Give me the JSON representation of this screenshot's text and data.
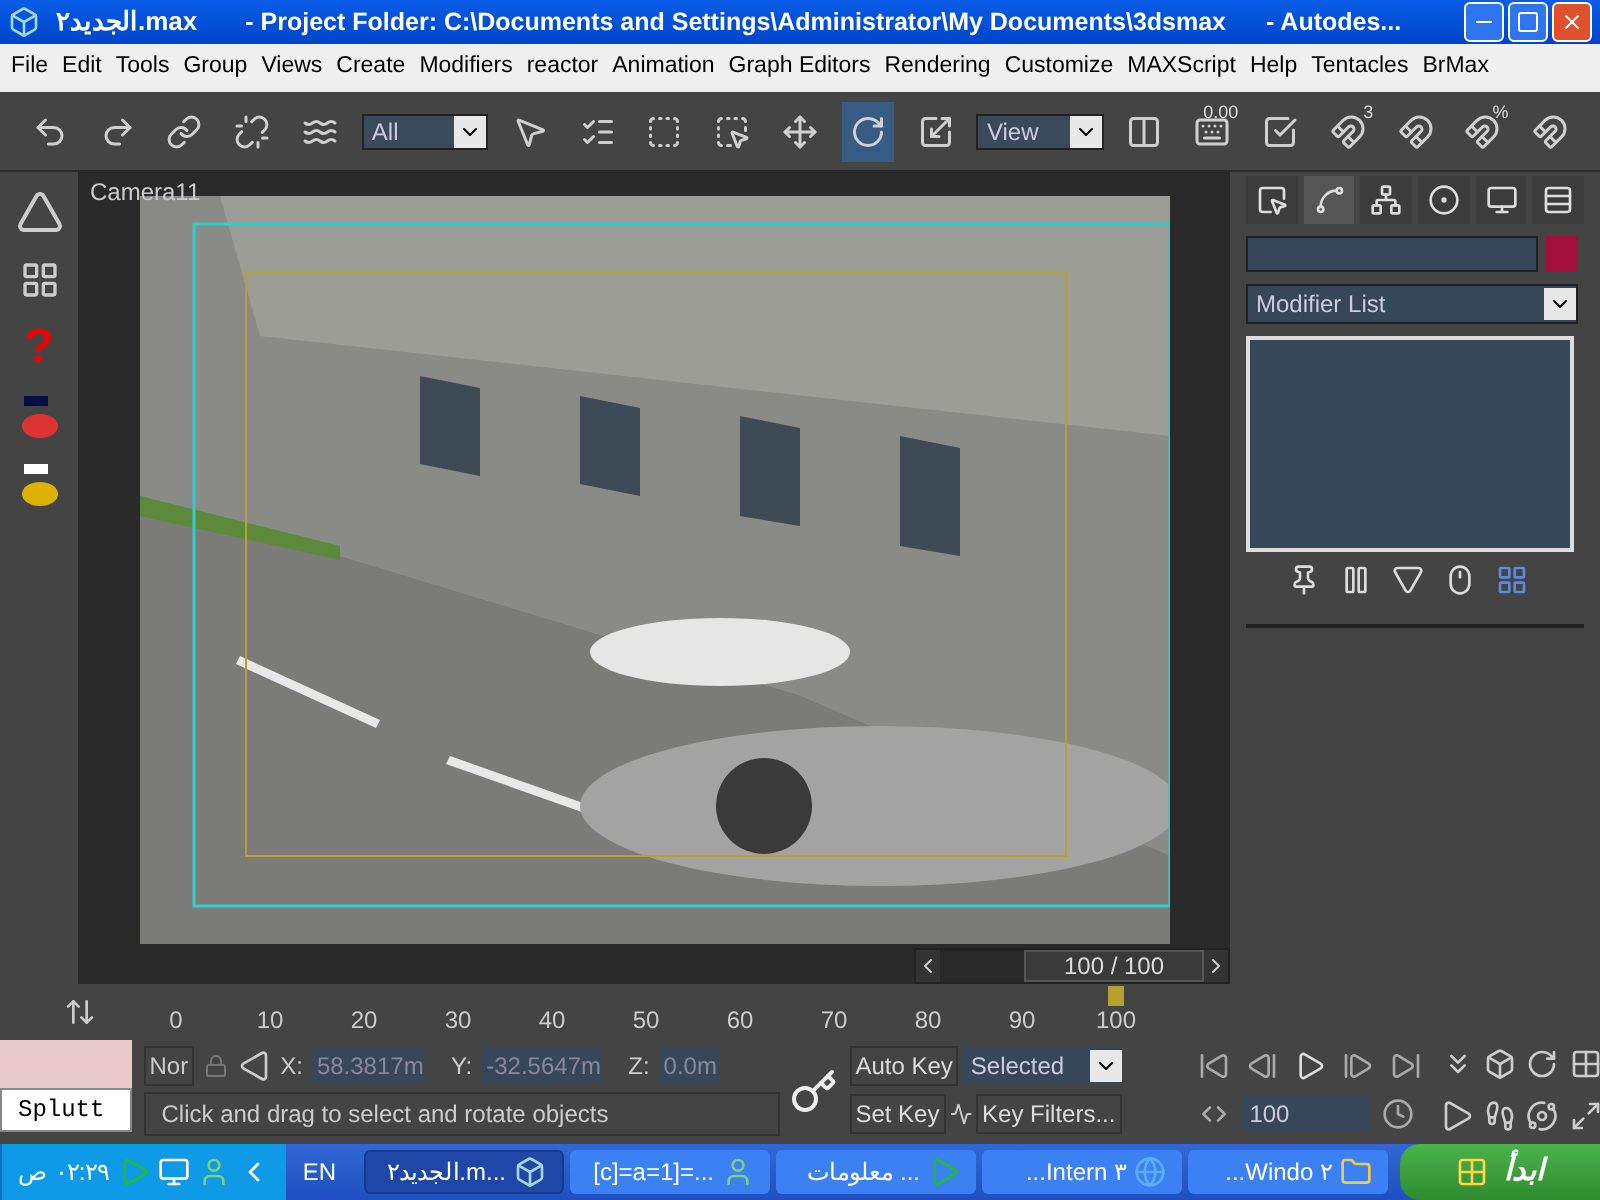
{
  "window": {
    "file_name": "الجديد٢.max",
    "project": "- Project Folder: C:\\Documents and Settings\\Administrator\\My Documents\\3dsmax",
    "app": "- Autodes..."
  },
  "menu": [
    "File",
    "Edit",
    "Tools",
    "Group",
    "Views",
    "Create",
    "Modifiers",
    "reactor",
    "Animation",
    "Graph Editors",
    "Rendering",
    "Customize",
    "MAXScript",
    "Help",
    "Tentacles",
    "BrMax"
  ],
  "toolbar": [
    {
      "kind": "undo",
      "selected": false
    },
    {
      "kind": "redo",
      "selected": false
    },
    {
      "kind": "link",
      "selected": false
    },
    {
      "kind": "unlink",
      "selected": false
    },
    {
      "kind": "bind",
      "selected": false
    },
    {
      "kind": "dropdown",
      "value": "All"
    },
    {
      "kind": "select",
      "selected": false
    },
    {
      "kind": "select-by-name",
      "selected": false
    },
    {
      "kind": "region",
      "selected": false
    },
    {
      "kind": "crossing",
      "selected": false
    },
    {
      "kind": "move",
      "selected": false
    },
    {
      "kind": "rotate",
      "selected": true
    },
    {
      "kind": "scale",
      "selected": false
    },
    {
      "kind": "dropdown",
      "value": "View"
    },
    {
      "kind": "pivot",
      "selected": false
    },
    {
      "kind": "keyboard",
      "label": "0.00",
      "selected": false
    },
    {
      "kind": "override",
      "selected": false
    },
    {
      "kind": "snap",
      "label": "3",
      "selected": false
    },
    {
      "kind": "angle-snap",
      "selected": false
    },
    {
      "kind": "percent-snap",
      "label": "%",
      "selected": false
    },
    {
      "kind": "spinner-snap",
      "selected": false
    }
  ],
  "viewport": {
    "label": "Camera11"
  },
  "left_toolbar": {
    "help": "?"
  },
  "command_panel": {
    "tabs": [
      {
        "kind": "create",
        "selected": false
      },
      {
        "kind": "modify",
        "selected": true
      },
      {
        "kind": "hierarchy",
        "selected": false
      },
      {
        "kind": "motion",
        "selected": false
      },
      {
        "kind": "display",
        "selected": false
      },
      {
        "kind": "utilities",
        "selected": false
      }
    ],
    "modifier_list": "Modifier List"
  },
  "time_slider": {
    "label": "100 / 100"
  },
  "timeline": {
    "ticks": [
      "0",
      "10",
      "20",
      "30",
      "40",
      "50",
      "60",
      "70",
      "80",
      "90",
      "100"
    ]
  },
  "status": {
    "listener": "Splutt",
    "mode": "Nor",
    "x_label": "X:",
    "x": "58.3817m",
    "y_label": "Y:",
    "y": "-32.5647m",
    "z_label": "Z:",
    "z": "0.0m",
    "prompt": "Click and drag to select and rotate objects"
  },
  "animation": {
    "auto_key": "Auto Key",
    "set_key": "Set Key",
    "key_mode": "Selected",
    "key_filters": "Key Filters...",
    "frame": "100"
  },
  "taskbar": {
    "start": "ابدأ",
    "tasks": [
      {
        "label": "الجديد٢.m...",
        "kind": "max",
        "selected": true
      },
      {
        "label": "[c]=a=1]=...",
        "kind": "user",
        "selected": false
      },
      {
        "label": "معلومات ...",
        "kind": "play",
        "selected": false
      },
      {
        "label": "...Intern ٣",
        "kind": "browser",
        "selected": false
      },
      {
        "label": "...Windo ٢",
        "kind": "folder",
        "selected": false
      }
    ],
    "language": "EN",
    "clock": "٠٢:٢٩ ص"
  }
}
